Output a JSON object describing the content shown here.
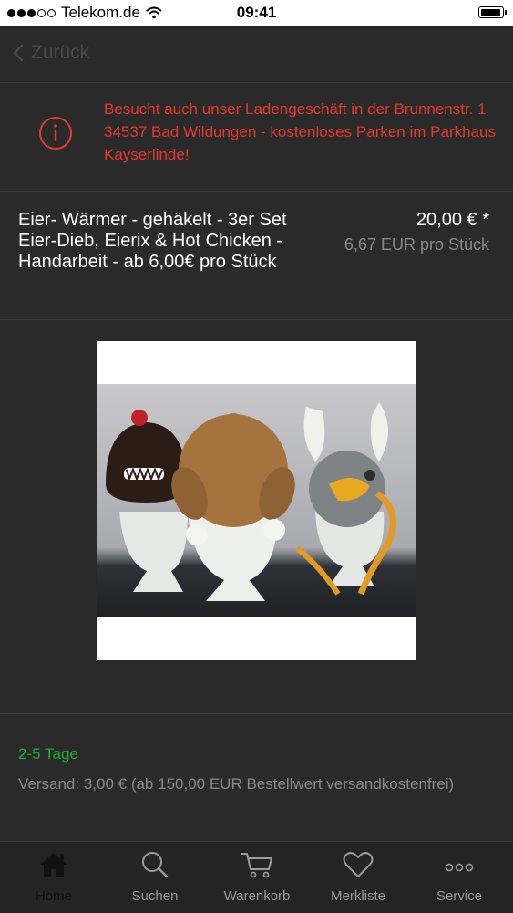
{
  "statusbar": {
    "carrier": "Telekom.de",
    "time": "09:41"
  },
  "navbar": {
    "back_label": "Zurück"
  },
  "notice": {
    "text": "Besucht auch unser Ladengeschäft in der Brunnenstr. 1 34537 Bad Wildungen - kostenloses Parken im Parkhaus Kayserlinde!"
  },
  "product": {
    "title": "Eier- Wärmer - gehäkelt - 3er Set Eier-Dieb, Eierix & Hot Chicken - Handarbeit - ab 6,00€ pro Stück",
    "price": "20,00 € *",
    "unit_price": "6,67 EUR pro Stück"
  },
  "delivery": {
    "days": "2-5 Tage",
    "shipping": "Versand: 3,00 € (ab 150,00 EUR Bestellwert versandkostenfrei)"
  },
  "tabs": [
    {
      "label": "Home",
      "icon": "home-icon"
    },
    {
      "label": "Suchen",
      "icon": "search-icon"
    },
    {
      "label": "Warenkorb",
      "icon": "cart-icon"
    },
    {
      "label": "Merkliste",
      "icon": "heart-icon"
    },
    {
      "label": "Service",
      "icon": "more-icon"
    }
  ],
  "colors": {
    "accent_red": "#e8382b",
    "green": "#1fae2d",
    "background": "#2a2a2a"
  }
}
